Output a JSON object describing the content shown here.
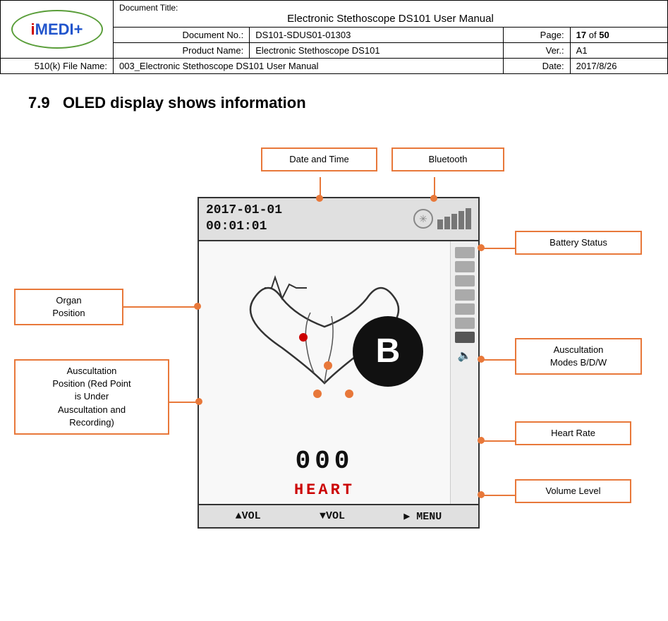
{
  "header": {
    "logo_text": "iMEDI+",
    "doc_title_label": "Document Title:",
    "doc_title": "Electronic Stethoscope DS101 User Manual",
    "doc_no_label": "Document No.:",
    "doc_no": "DS101-SDUS01-01303",
    "page_label": "Page:",
    "page_current": "17",
    "page_total": "50",
    "product_label": "Product Name:",
    "product": "Electronic Stethoscope DS101",
    "ver_label": "Ver.:",
    "ver": "A1",
    "file_label": "510(k) File Name:",
    "file": "003_Electronic Stethoscope DS101 User Manual",
    "date_label": "Date:",
    "date": "2017/8/26"
  },
  "section": {
    "number": "7.9",
    "title": "OLED display shows information"
  },
  "device": {
    "datetime_line1": "2017-01-01",
    "datetime_line2": "00:01:01",
    "heart_label": "HEART",
    "digits": "000",
    "big_letter": "B",
    "bottom_vol_up": "▲VOL",
    "bottom_vol_down": "▼VOL",
    "bottom_menu": "▶ MENU"
  },
  "annotations": {
    "date_time": "Date and Time",
    "bluetooth": "Bluetooth",
    "battery_status": "Battery Status",
    "organ_position": "Organ\nPosition",
    "auscultation_position": "Auscultation\nPosition (Red Point\nis Under\nAuscultation and\nRecording)",
    "auscultation_modes": "Auscultation\nModes B/D/W",
    "heart_rate": "Heart Rate",
    "volume_level": "Volume Level"
  }
}
